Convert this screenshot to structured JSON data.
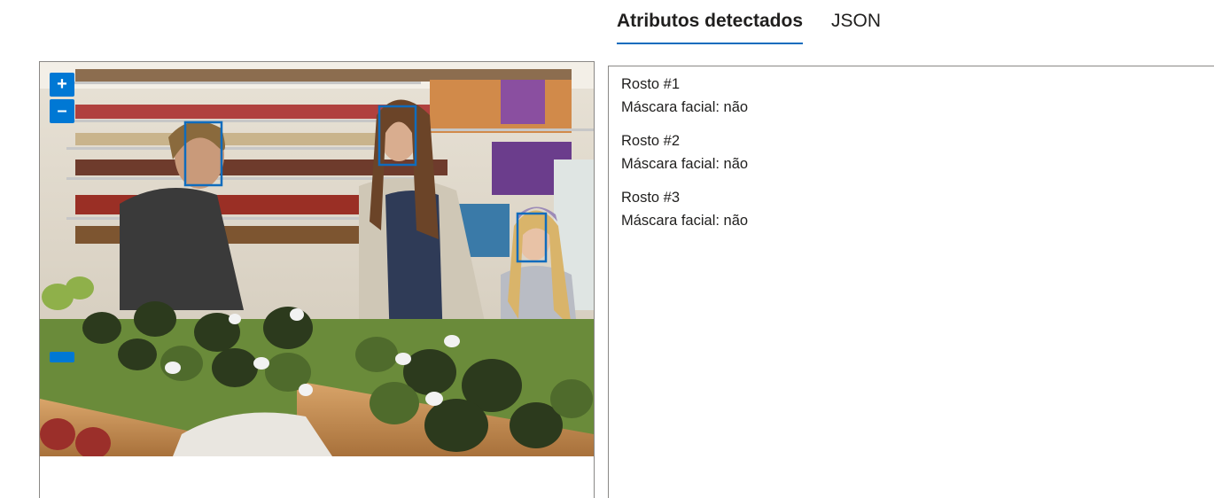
{
  "tabs": [
    {
      "label": "Atributos detectados",
      "active": true
    },
    {
      "label": "JSON",
      "active": false
    }
  ],
  "viewer": {
    "zoom_in_label": "+",
    "zoom_out_label": "–",
    "accent_color": "#0078d4"
  },
  "faces": [
    {
      "title": "Rosto #1",
      "attribute": "Máscara facial: não"
    },
    {
      "title": "Rosto #2",
      "attribute": "Máscara facial: não"
    },
    {
      "title": "Rosto #3",
      "attribute": "Máscara facial: não"
    }
  ]
}
